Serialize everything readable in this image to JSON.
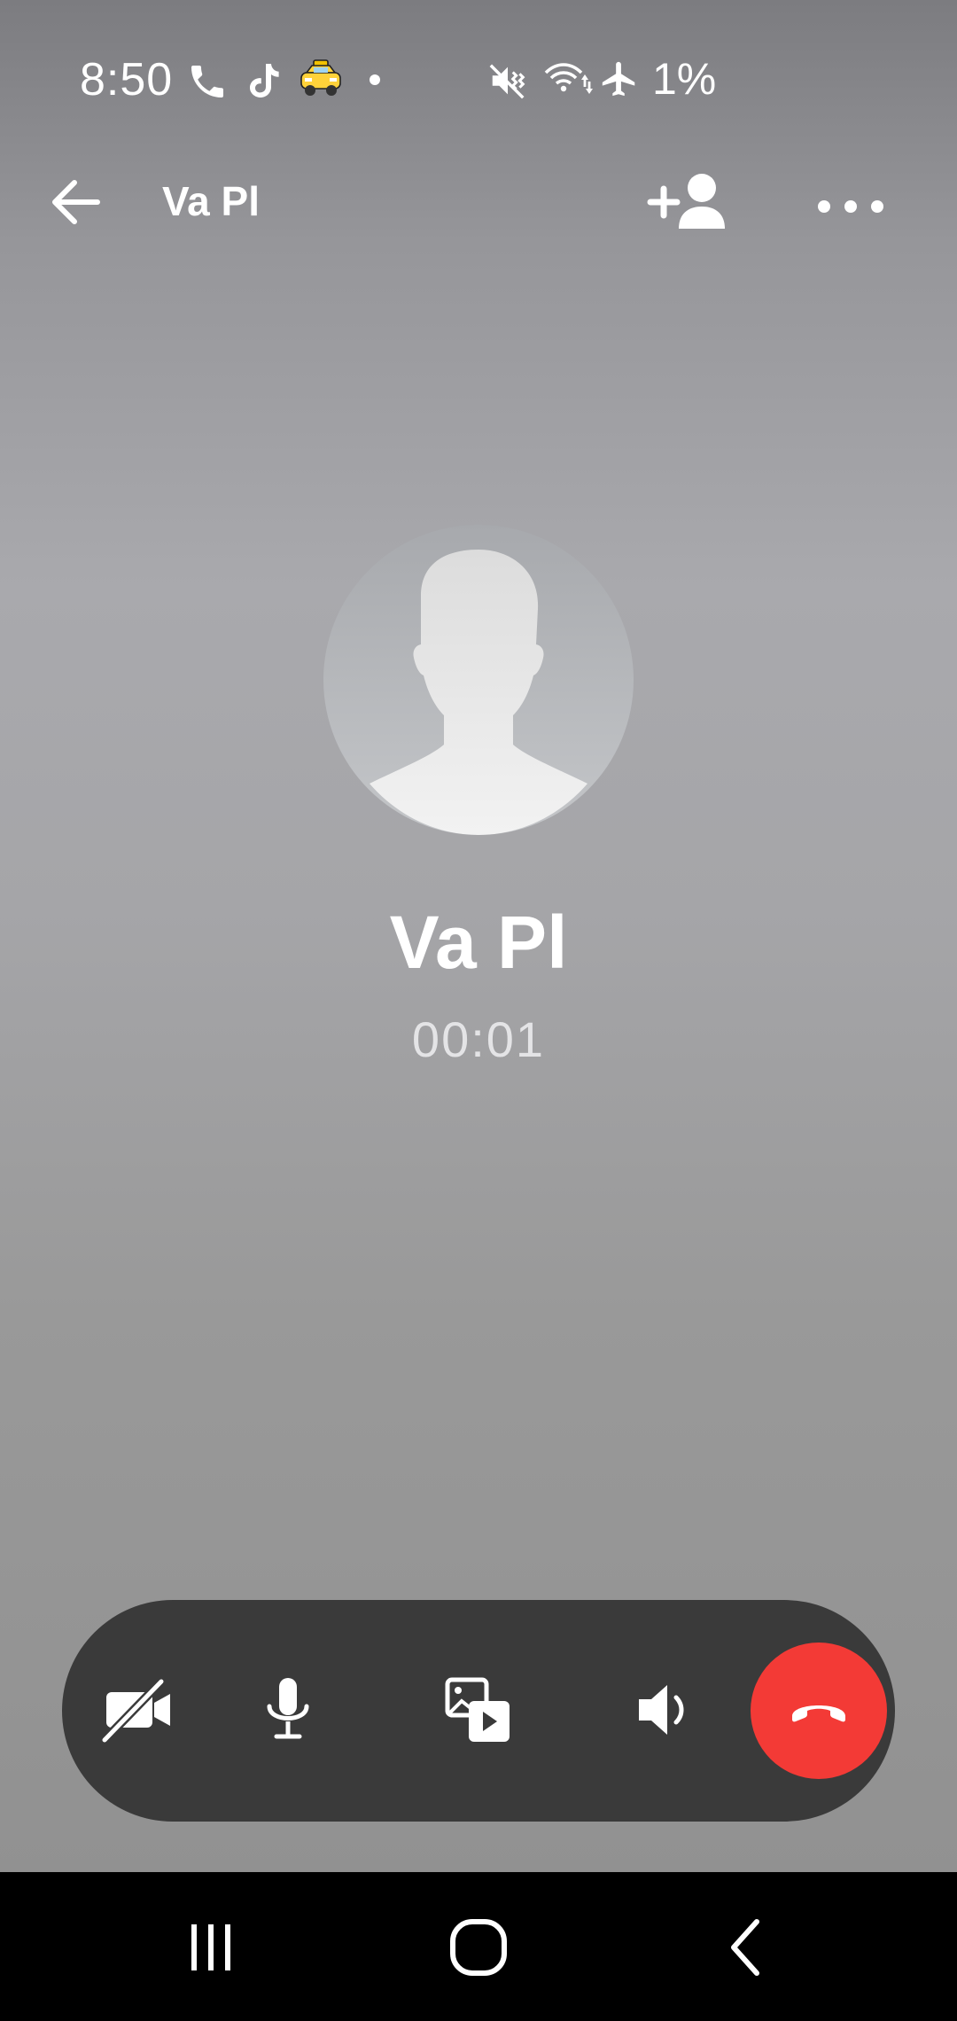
{
  "status_bar": {
    "time": "8:50",
    "battery": "1%",
    "icons": [
      "phone-call-icon",
      "tiktok-icon",
      "taxi-icon",
      "notification-dot-icon",
      "mute-vibrate-icon",
      "wifi-icon",
      "airplane-mode-icon"
    ]
  },
  "top_bar": {
    "title": "Va Pl",
    "icons": [
      "back-arrow-icon",
      "add-person-icon",
      "more-options-icon"
    ]
  },
  "call": {
    "name": "Va Pl",
    "timer": "00:01"
  },
  "controls": {
    "items": [
      "video-off-icon",
      "microphone-icon",
      "share-media-icon",
      "speaker-icon",
      "end-call-icon"
    ]
  },
  "colors": {
    "end_call": "#f33a36",
    "control_bar": "#3a3a3a",
    "nav_bar": "#000000",
    "text": "#ffffff"
  },
  "nav_bar": {
    "items": [
      "recent-apps-icon",
      "home-icon",
      "back-icon"
    ]
  }
}
